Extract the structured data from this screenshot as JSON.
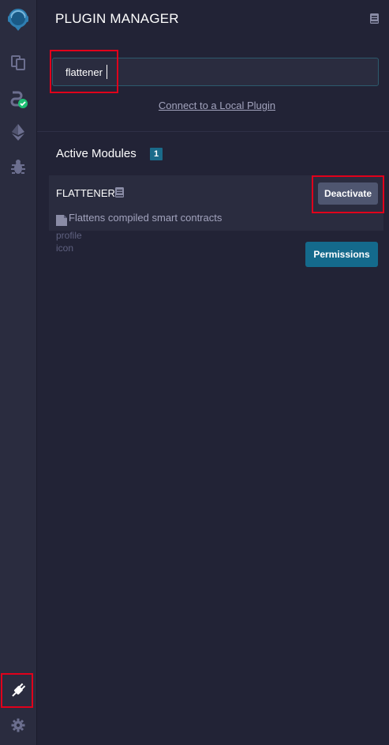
{
  "icon_panel": {
    "items": [
      {
        "name": "remix-logo-icon"
      },
      {
        "name": "file-explorer-icon"
      },
      {
        "name": "solidity-compiler-icon"
      },
      {
        "name": "deploy-run-icon"
      },
      {
        "name": "debugger-icon"
      }
    ],
    "plugin_label": "flattener",
    "plugin_manager_icon": "plug-icon",
    "settings_icon": "gear-icon"
  },
  "header": {
    "title": "PLUGIN MANAGER",
    "doc_icon": "book-icon"
  },
  "search": {
    "value": "flattener",
    "placeholder": ""
  },
  "connect_link": "Connect to a Local Plugin",
  "active_modules": {
    "heading": "Active Modules",
    "count": "1",
    "modules": [
      {
        "name": "FLATTENER",
        "description": "Flattens compiled smart contracts",
        "deactivate_label": "Deactivate",
        "permissions_label": "Permissions",
        "profile_icon_alt": [
          "profile",
          "icon"
        ]
      }
    ]
  },
  "colors": {
    "background": "#222336",
    "side_panel": "#2a2c3f",
    "accent": "#146a8c",
    "highlight": "#e0001b",
    "success": "#1dbf73"
  }
}
